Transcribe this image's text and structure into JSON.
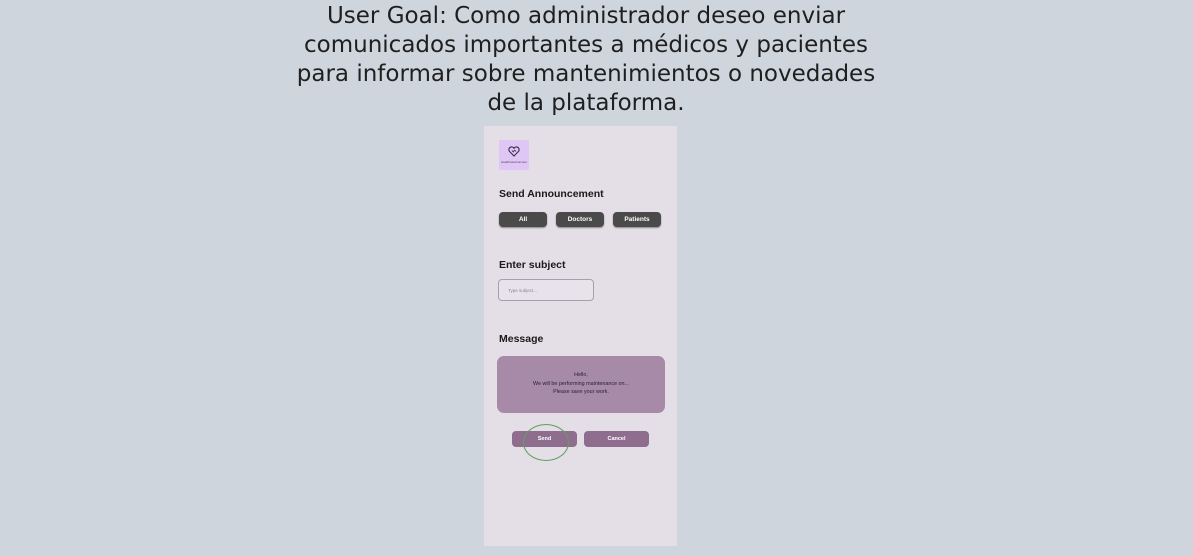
{
  "user_goal": {
    "lines": [
      "User Goal: Como administrador deseo enviar",
      "comunicados importantes a médicos y pacientes",
      "para informar sobre mantenimientos o novedades",
      "de la plataforma."
    ]
  },
  "app": {
    "logo_text": "HealthcareConnect",
    "logo_icon": "heart-stethoscope-icon",
    "section_title": "Send Announcement",
    "audience_buttons": [
      "All",
      "Doctors",
      "Patients"
    ],
    "subject": {
      "label": "Enter subject",
      "placeholder": "Type subject..."
    },
    "message": {
      "label": "Message",
      "lines": [
        "Hello,",
        "We will be performing maintenance on...",
        "Please save your work."
      ]
    },
    "actions": {
      "send": "Send",
      "cancel": "Cancel"
    },
    "colors": {
      "background": "#ced5dd",
      "phone_background": "#e4dee6",
      "audience_button": "#4a4a4a",
      "message_box": "#a78aa8",
      "action_button": "#8e6d8f",
      "click_highlight": "#5fa060"
    }
  }
}
